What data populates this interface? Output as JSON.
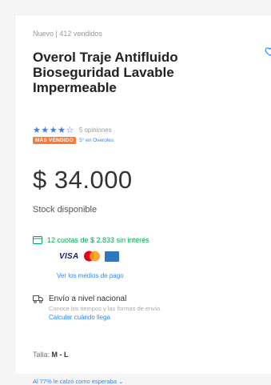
{
  "product": {
    "condition": "Nuevo | 412 vendidos",
    "title": "Overol Traje Antifluido Bioseguridad Lavable Impermeable",
    "rating": {
      "stars": "★★★★☆",
      "reviews": "5 opiniones"
    },
    "badge": {
      "label": "MÁS VENDIDO",
      "note": "5° en Overoles"
    },
    "price": "$ 34.000",
    "stock": "Stock disponible"
  },
  "payment": {
    "installments": "12 cuotas de $ 2.833 sin interés",
    "cards": {
      "visa": "VISA"
    },
    "link": "Ver los medios de pago"
  },
  "shipping": {
    "title": "Envío a nivel nacional",
    "subtitle": "Conoce los tiempos y las formas de envío.",
    "link": "Calcular cuándo llega"
  },
  "size": {
    "label": "Talla:",
    "value": "M - L"
  },
  "fit": "Al 77% le calzó como esperaba",
  "colors": {
    "accent": "#3483fa",
    "success": "#00a650",
    "badge": "#ff7733"
  },
  "icons": [
    "heart-icon",
    "card-icon",
    "truck-icon",
    "chevron-down-icon"
  ]
}
